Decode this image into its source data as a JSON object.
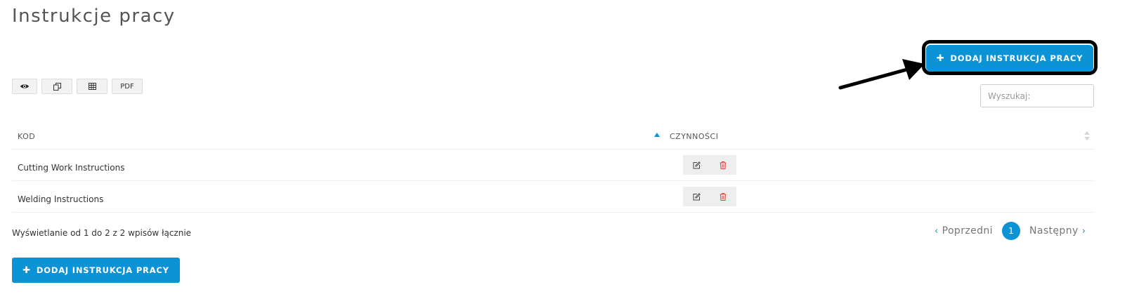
{
  "page": {
    "title": "Instrukcje pracy"
  },
  "toolbar": {
    "add_label": "DODAJ INSTRUKCJA PRACY",
    "add_icon": "plus-icon",
    "accent_color": "#0b93d5"
  },
  "export_buttons": [
    {
      "icon": "eye-icon"
    },
    {
      "icon": "copy-icon"
    },
    {
      "icon": "table-icon"
    },
    {
      "label": "PDF"
    }
  ],
  "search": {
    "placeholder": "Wyszukaj:",
    "value": ""
  },
  "table": {
    "columns": [
      "KOD",
      "CZYNNOŚCI"
    ],
    "sort": {
      "column": "KOD",
      "direction": "asc"
    },
    "rows": [
      {
        "name": "Cutting Work Instructions",
        "actions": [
          "edit-icon",
          "trash-icon"
        ]
      },
      {
        "name": "Welding Instructions",
        "actions": [
          "edit-icon",
          "trash-icon"
        ]
      }
    ]
  },
  "footer": {
    "info": "Wyświetlanie od 1 do 2 z 2 wpisów łącznie"
  },
  "pagination": {
    "prev_label": "Poprzedni",
    "next_label": "Następny",
    "current_page": "1"
  },
  "annotation": {
    "highlight_color": "#000000"
  }
}
